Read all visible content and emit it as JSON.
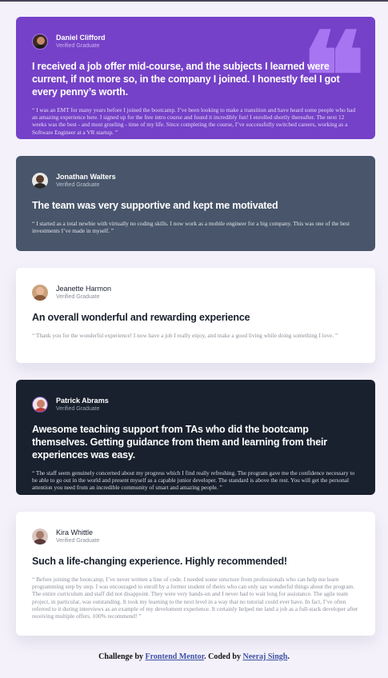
{
  "cards": [
    {
      "name": "Daniel Clifford",
      "role": "Verified Graduate",
      "title": "I received a job offer mid-course, and the subjects I learned were current, if not more so, in the company I joined. I honestly feel I got every penny’s worth.",
      "body": "“ I was an EMT for many years before I joined the bootcamp. I’ve been looking to make a transition and have heard some people who had an amazing experience here. I signed up for the free intro course and found it incredibly fun! I enrolled shortly thereafter. The next 12 weeks was the best - and most grueling - time of my life. Since completing the course, I’ve successfully switched careers, working as a Software Engineer at a VR startup. ”",
      "quote_glyph": "❝",
      "bg": "#7541c8",
      "avatar_icon": "avatar-daniel-icon"
    },
    {
      "name": "Jonathan Walters",
      "role": "Verified Graduate",
      "title": "The team was very supportive and kept me motivated",
      "body": "“ I started as a total newbie with virtually no coding skills. I now work as a mobile engineer for a big company. This was one of the best investments I’ve made in myself. ”",
      "bg": "#48556a",
      "avatar_icon": "avatar-jonathan-icon"
    },
    {
      "name": "Jeanette Harmon",
      "role": "Verified Graduate",
      "title": "An overall wonderful and rewarding experience",
      "body": "“ Thank you for the wonderful experience! I now have a job I really enjoy, and make a good living while doing something I love. ”",
      "bg": "#ffffff",
      "avatar_icon": "avatar-jeanette-icon"
    },
    {
      "name": "Patrick Abrams",
      "role": "Verified Graduate",
      "title": "Awesome teaching support from TAs who did the bootcamp themselves. Getting guidance from them and learning from their experiences was easy.",
      "body": "“ The staff seem genuinely concerned about my progress which I find really refreshing. The program gave me the confidence necessary to be able to go out in the world and present myself as a capable junior developer. The standard is above the rest. You will get the personal attention you need from an incredible community of smart and amazing people. ”",
      "bg": "#19212e",
      "avatar_icon": "avatar-patrick-icon"
    },
    {
      "name": "Kira Whittle",
      "role": "Verified Graduate",
      "title": "Such a life-changing experience. Highly recommended!",
      "body": "“ Before joining the bootcamp, I’ve never written a line of code. I needed some structure from professionals who can help me learn programming step by step. I was encouraged to enroll by a former student of theirs who can only say wonderful things about the program. The entire curriculum and staff did not disappoint. They were very hands-on and I never had to wait long for assistance. The agile team project, in particular, was outstanding. It took my learning to the next level in a way that no tutorial could ever have. In fact, I’ve often referred to it during interviews as an example of my develoment experience. It certainly helped me land a job as a full-stack developer after receiving multiple offers. 100% recommend! ”",
      "bg": "#ffffff",
      "avatar_icon": "avatar-kira-icon"
    }
  ],
  "footer": {
    "prefix": "Challenge by ",
    "link1": "Frontend Mentor",
    "middle": ". Coded by ",
    "link2": "Neeraj Singh",
    "suffix": "."
  }
}
